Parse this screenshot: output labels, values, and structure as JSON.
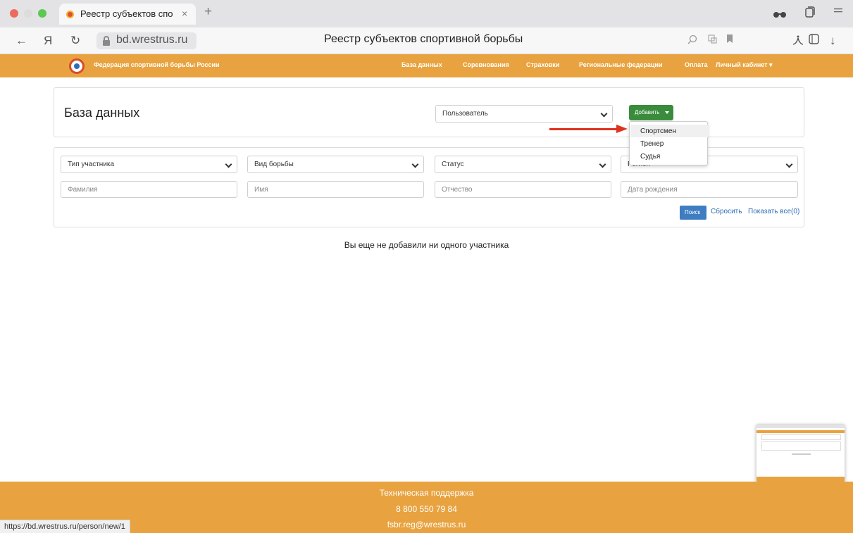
{
  "browser": {
    "tab_title": "Реестр субъектов спо",
    "tab_close": "×",
    "new_tab": "+",
    "url": "bd.wrestrus.ru",
    "page_title": "Реестр субъектов спортивной борьбы",
    "status_url": "https://bd.wrestrus.ru/person/new/1",
    "icons": {
      "back": "←",
      "yandex": "Я",
      "reload": "↻",
      "download": "↓"
    }
  },
  "navbar": {
    "brand": "Федерация спортивной борьбы России",
    "items": [
      "База данных",
      "Соревнования",
      "Страховки",
      "Региональные федерации",
      "Оплата",
      "Личный кабинет ▾"
    ]
  },
  "main": {
    "heading": "База данных",
    "type_select": "Пользователь",
    "add_button": "Добавить",
    "add_menu": [
      "Спортсмен",
      "Тренер",
      "Судья"
    ],
    "add_menu_active": 0
  },
  "filters": {
    "selects": [
      "Тип участника",
      "Вид борьбы",
      "Статус",
      "Регион"
    ],
    "inputs": [
      "Фамилия",
      "Имя",
      "Отчество",
      "Дата рождения"
    ],
    "search_button": "Поиск",
    "reset_link": "Сбросить",
    "show_all_link": "Показать все(0)"
  },
  "empty_message": "Вы еще не добавили ни одного участника",
  "footer": {
    "title": "Техническая поддержка",
    "phone": "8 800 550 79 84",
    "email": "fsbr.reg@wrestrus.ru"
  },
  "colors": {
    "accent": "#e8a340",
    "add_button": "#3a8c3c",
    "search_button": "#3e7dc2",
    "link": "#2e6db3",
    "arrow": "#e0321e"
  }
}
